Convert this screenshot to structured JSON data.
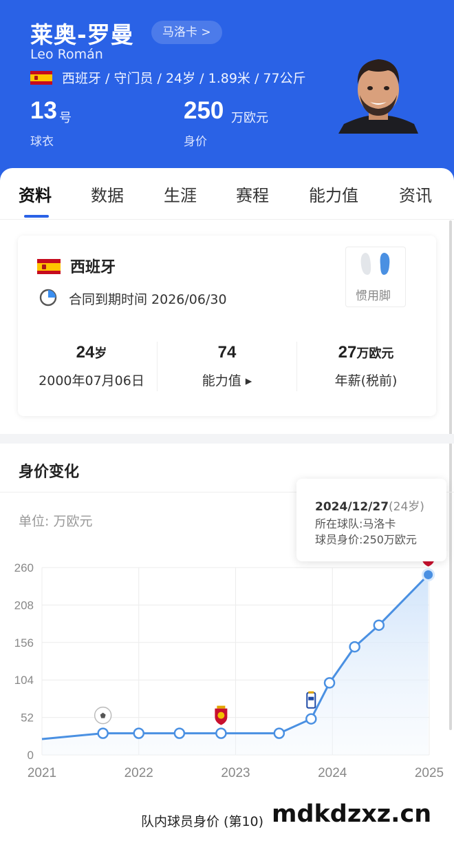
{
  "player": {
    "name_cn": "莱奥-罗曼",
    "name_en": "Leo Román",
    "club_link": "马洛卡 >",
    "info_line": "西班牙 / 守门员 / 24岁 / 1.89米 / 77公斤",
    "jersey_number": "13",
    "jersey_unit": "号",
    "jersey_label": "球衣",
    "value_number": "250",
    "value_unit": "万欧元",
    "value_label": "身价"
  },
  "tabs": [
    {
      "label": "资料",
      "active": true
    },
    {
      "label": "数据"
    },
    {
      "label": "生涯"
    },
    {
      "label": "赛程"
    },
    {
      "label": "能力值"
    },
    {
      "label": "资讯"
    }
  ],
  "profile_card": {
    "country": "西班牙",
    "contract_text": "合同到期时间 2026/06/30",
    "preferred_foot_label": "惯用脚",
    "age_value": "24",
    "age_unit": "岁",
    "birth_date": "2000年07月06日",
    "ability_value": "74",
    "ability_label": "能力值 ▸",
    "salary_value": "27",
    "salary_unit": "万欧元",
    "salary_label": "年薪(税前)"
  },
  "market_value": {
    "title": "身价变化",
    "unit_label": "单位:  万欧元",
    "tooltip": {
      "date": "2024/12/27",
      "age": "(24岁)",
      "team": "所在球队:马洛卡",
      "value": "球员身价:250万欧元"
    }
  },
  "chart_data": {
    "type": "area",
    "x_tick_labels": [
      "2021",
      "2022",
      "2023",
      "2024",
      "2025"
    ],
    "y_tick_labels": [
      "0",
      "52",
      "104",
      "156",
      "208",
      "260"
    ],
    "ylim": [
      0,
      260
    ],
    "xlim": [
      2021.0,
      2025.0
    ],
    "grid": true,
    "series": [
      {
        "x": [
          2021.0,
          2021.63,
          2022.0,
          2022.42,
          2022.85,
          2023.45,
          2023.78,
          2023.97,
          2024.23,
          2024.48,
          2024.99
        ],
        "y": [
          22,
          30,
          30,
          30,
          30,
          30,
          50,
          100,
          150,
          180,
          250
        ]
      }
    ],
    "club_badges": [
      {
        "x": 2021.63,
        "icon": "soccer-ball-icon"
      },
      {
        "x": 2022.85,
        "icon": "mallorca-badge-icon"
      },
      {
        "x": 2023.78,
        "icon": "oviedo-badge-icon"
      },
      {
        "x": 2024.99,
        "icon": "mallorca-badge-icon"
      }
    ],
    "colors": {
      "line": "#4a90e2",
      "fill_top": "#cfe3fa",
      "grid": "#ececec",
      "axis_text": "#888888"
    }
  },
  "bottom_section_title": "队内球员身价 (第10)",
  "watermark": "mdkdzxz.cn"
}
